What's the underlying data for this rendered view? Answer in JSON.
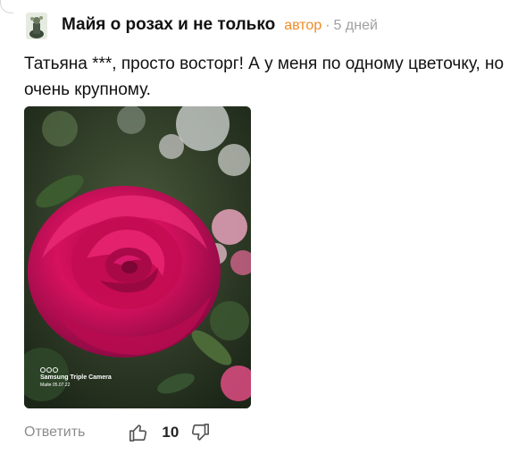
{
  "comment": {
    "author": "Майя о розах и не только",
    "badge": "автор",
    "separator": "·",
    "time": "5 дней",
    "text": "Татьяна ***, просто восторг! А у меня по одному цветочку, но очень крупному."
  },
  "photo": {
    "watermark_title": "Samsung Triple Camera",
    "watermark_date": "Майя 05.07.22"
  },
  "actions": {
    "reply_label": "Ответить",
    "like_count": "10"
  },
  "colors": {
    "badge": "#f08a24",
    "muted": "#a0a0a0",
    "rose": "#d6115e"
  }
}
